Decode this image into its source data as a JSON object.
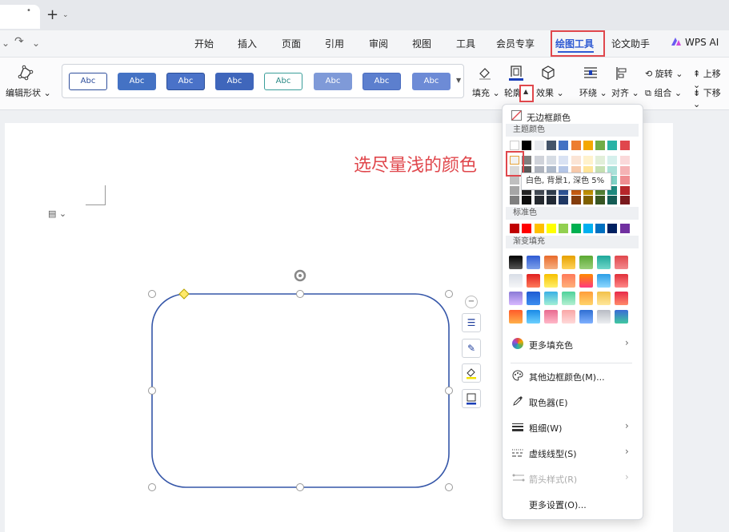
{
  "titlebar": {
    "tab_dot": "•",
    "new_tab": "+",
    "new_tab_menu": "⌄"
  },
  "quick_access": {
    "undo_menu": "⌄",
    "redo": "↷",
    "redo_menu": "⌄"
  },
  "menu": [
    "开始",
    "插入",
    "页面",
    "引用",
    "审阅",
    "视图",
    "工具",
    "会员专享",
    "绘图工具",
    "论文助手",
    "WPS AI"
  ],
  "ribbon": {
    "edit_shape": "编辑形状",
    "styles": [
      {
        "label": "Abc",
        "bg": "#ffffff",
        "fg": "#2f4f9c",
        "border": "#2f4f9c"
      },
      {
        "label": "Abc",
        "bg": "#4472c4",
        "fg": "#ffffff",
        "border": "#4472c4"
      },
      {
        "label": "Abc",
        "bg": "#4a72c8",
        "fg": "#ffffff",
        "border": "#2c4f99"
      },
      {
        "label": "Abc",
        "bg": "#3f66bb",
        "fg": "#ffffff",
        "border": "#3f66bb"
      },
      {
        "label": "Abc",
        "bg": "#ffffff",
        "fg": "#2a8a86",
        "border": "#3a9e9a"
      },
      {
        "label": "Abc",
        "bg": "#7f9ad8",
        "fg": "#ffffff",
        "border": "#7f9ad8"
      },
      {
        "label": "Abc",
        "bg": "#5c7fce",
        "fg": "#ffffff",
        "border": "#4a6cbf"
      },
      {
        "label": "Abc",
        "bg": "#6d8bd6",
        "fg": "#ffffff",
        "border": "#6d8bd6"
      }
    ],
    "fill": "填充",
    "outline": "轮廓",
    "effects": "效果",
    "wrap": "环绕",
    "align": "对齐",
    "rotate": "旋转",
    "group": "组合",
    "bring_forward": "上移",
    "send_backward": "下移"
  },
  "annotation": "选尽量浅的颜色",
  "panel": {
    "no_border": "无边框颜色",
    "theme_colors_label": "主题颜色",
    "theme_top_row": [
      "#ffffff",
      "#000000",
      "#e7e9ee",
      "#44546a",
      "#4472c4",
      "#ed7d31",
      "#f4a700",
      "#70ad47",
      "#2ab3a6",
      "#e0474c"
    ],
    "theme_shades": [
      [
        "#f2f2f2",
        "#7f7f7f",
        "#d0d3da",
        "#d6dce4",
        "#d9e2f3",
        "#fbe4d5",
        "#fff2cc",
        "#e2efd9",
        "#d5f0ec",
        "#fad9da"
      ],
      [
        "#d9d9d9",
        "#595959",
        "#aeb3bd",
        "#adb9ca",
        "#b4c6e7",
        "#f7caac",
        "#ffe599",
        "#c5e0b3",
        "#aae1d9",
        "#f5b3b5"
      ],
      [
        "#bfbfbf",
        "#3f3f3f",
        "#7b8290",
        "#8496b0",
        "#8eaadb",
        "#f4b083",
        "#ffd966",
        "#a8d08d",
        "#80d2c6",
        "#ef8d91"
      ],
      [
        "#a6a6a6",
        "#262626",
        "#454b55",
        "#323f4f",
        "#2f5496",
        "#c55a11",
        "#bf8f00",
        "#538135",
        "#1e8a7f",
        "#b7262b"
      ],
      [
        "#7f7f7f",
        "#0d0d0d",
        "#262a30",
        "#222a35",
        "#1f3864",
        "#843c0c",
        "#7f6000",
        "#375623",
        "#145c55",
        "#7a191d"
      ]
    ],
    "tooltip": "白色, 背景1, 深色 5%",
    "standard_colors_label": "标准色",
    "standard_colors": [
      "#c00000",
      "#ff0000",
      "#ffc000",
      "#ffff00",
      "#92d050",
      "#00b050",
      "#00b0f0",
      "#0070c0",
      "#002060",
      "#7030a0"
    ],
    "gradient_label": "渐变填充",
    "gradients": [
      [
        "#000000",
        "#555555"
      ],
      [
        "#2f5bd3",
        "#7da0ea"
      ],
      [
        "#e86a2a",
        "#f6b083"
      ],
      [
        "#e6a100",
        "#ffd45a"
      ],
      [
        "#5aa832",
        "#9ad07a"
      ],
      [
        "#1ea89a",
        "#6fd6c9"
      ],
      [
        "#e0474c",
        "#f38a8e"
      ],
      [
        "#d8dde6",
        "#f5f6f8"
      ],
      [
        "#e02020",
        "#ff7a5a"
      ],
      [
        "#f7c000",
        "#fff06a"
      ],
      [
        "#ff7a5a",
        "#ffb07a"
      ],
      [
        "#ff8a00",
        "#ff3a80"
      ],
      [
        "#2b9fe6",
        "#8fd8ff"
      ],
      [
        "#e0303a",
        "#ff8888"
      ],
      [
        "#8a7ad6",
        "#d7b8ff"
      ],
      [
        "#1f5cd3",
        "#3c8ef0"
      ],
      [
        "#3ab0e6",
        "#a2f0d4"
      ],
      [
        "#4ed29a",
        "#b4f0d2"
      ],
      [
        "#ff9d3a",
        "#ffd46a"
      ],
      [
        "#f2c14a",
        "#ffe79a"
      ],
      [
        "#e82a4a",
        "#ff8a6a"
      ],
      [
        "#ff5a2a",
        "#ffb04a"
      ],
      [
        "#1a8ae6",
        "#6bd0ff"
      ],
      [
        "#e86a90",
        "#ffb8c8"
      ],
      [
        "#f9a7a7",
        "#ffd9d9"
      ],
      [
        "#2f6fd3",
        "#7fb0ff"
      ],
      [
        "#b8bcc4",
        "#eceef1"
      ],
      [
        "#3a6bd6",
        "#40c8a0"
      ]
    ],
    "more_fill": "更多填充色",
    "other_border": "其他边框颜色(M)...",
    "eyedropper": "取色器(E)",
    "weight": "粗细(W)",
    "dash": "虚线线型(S)",
    "arrow": "箭头样式(R)",
    "more_settings": "更多设置(O)..."
  },
  "side_toolbar": {
    "collapse": "−"
  }
}
